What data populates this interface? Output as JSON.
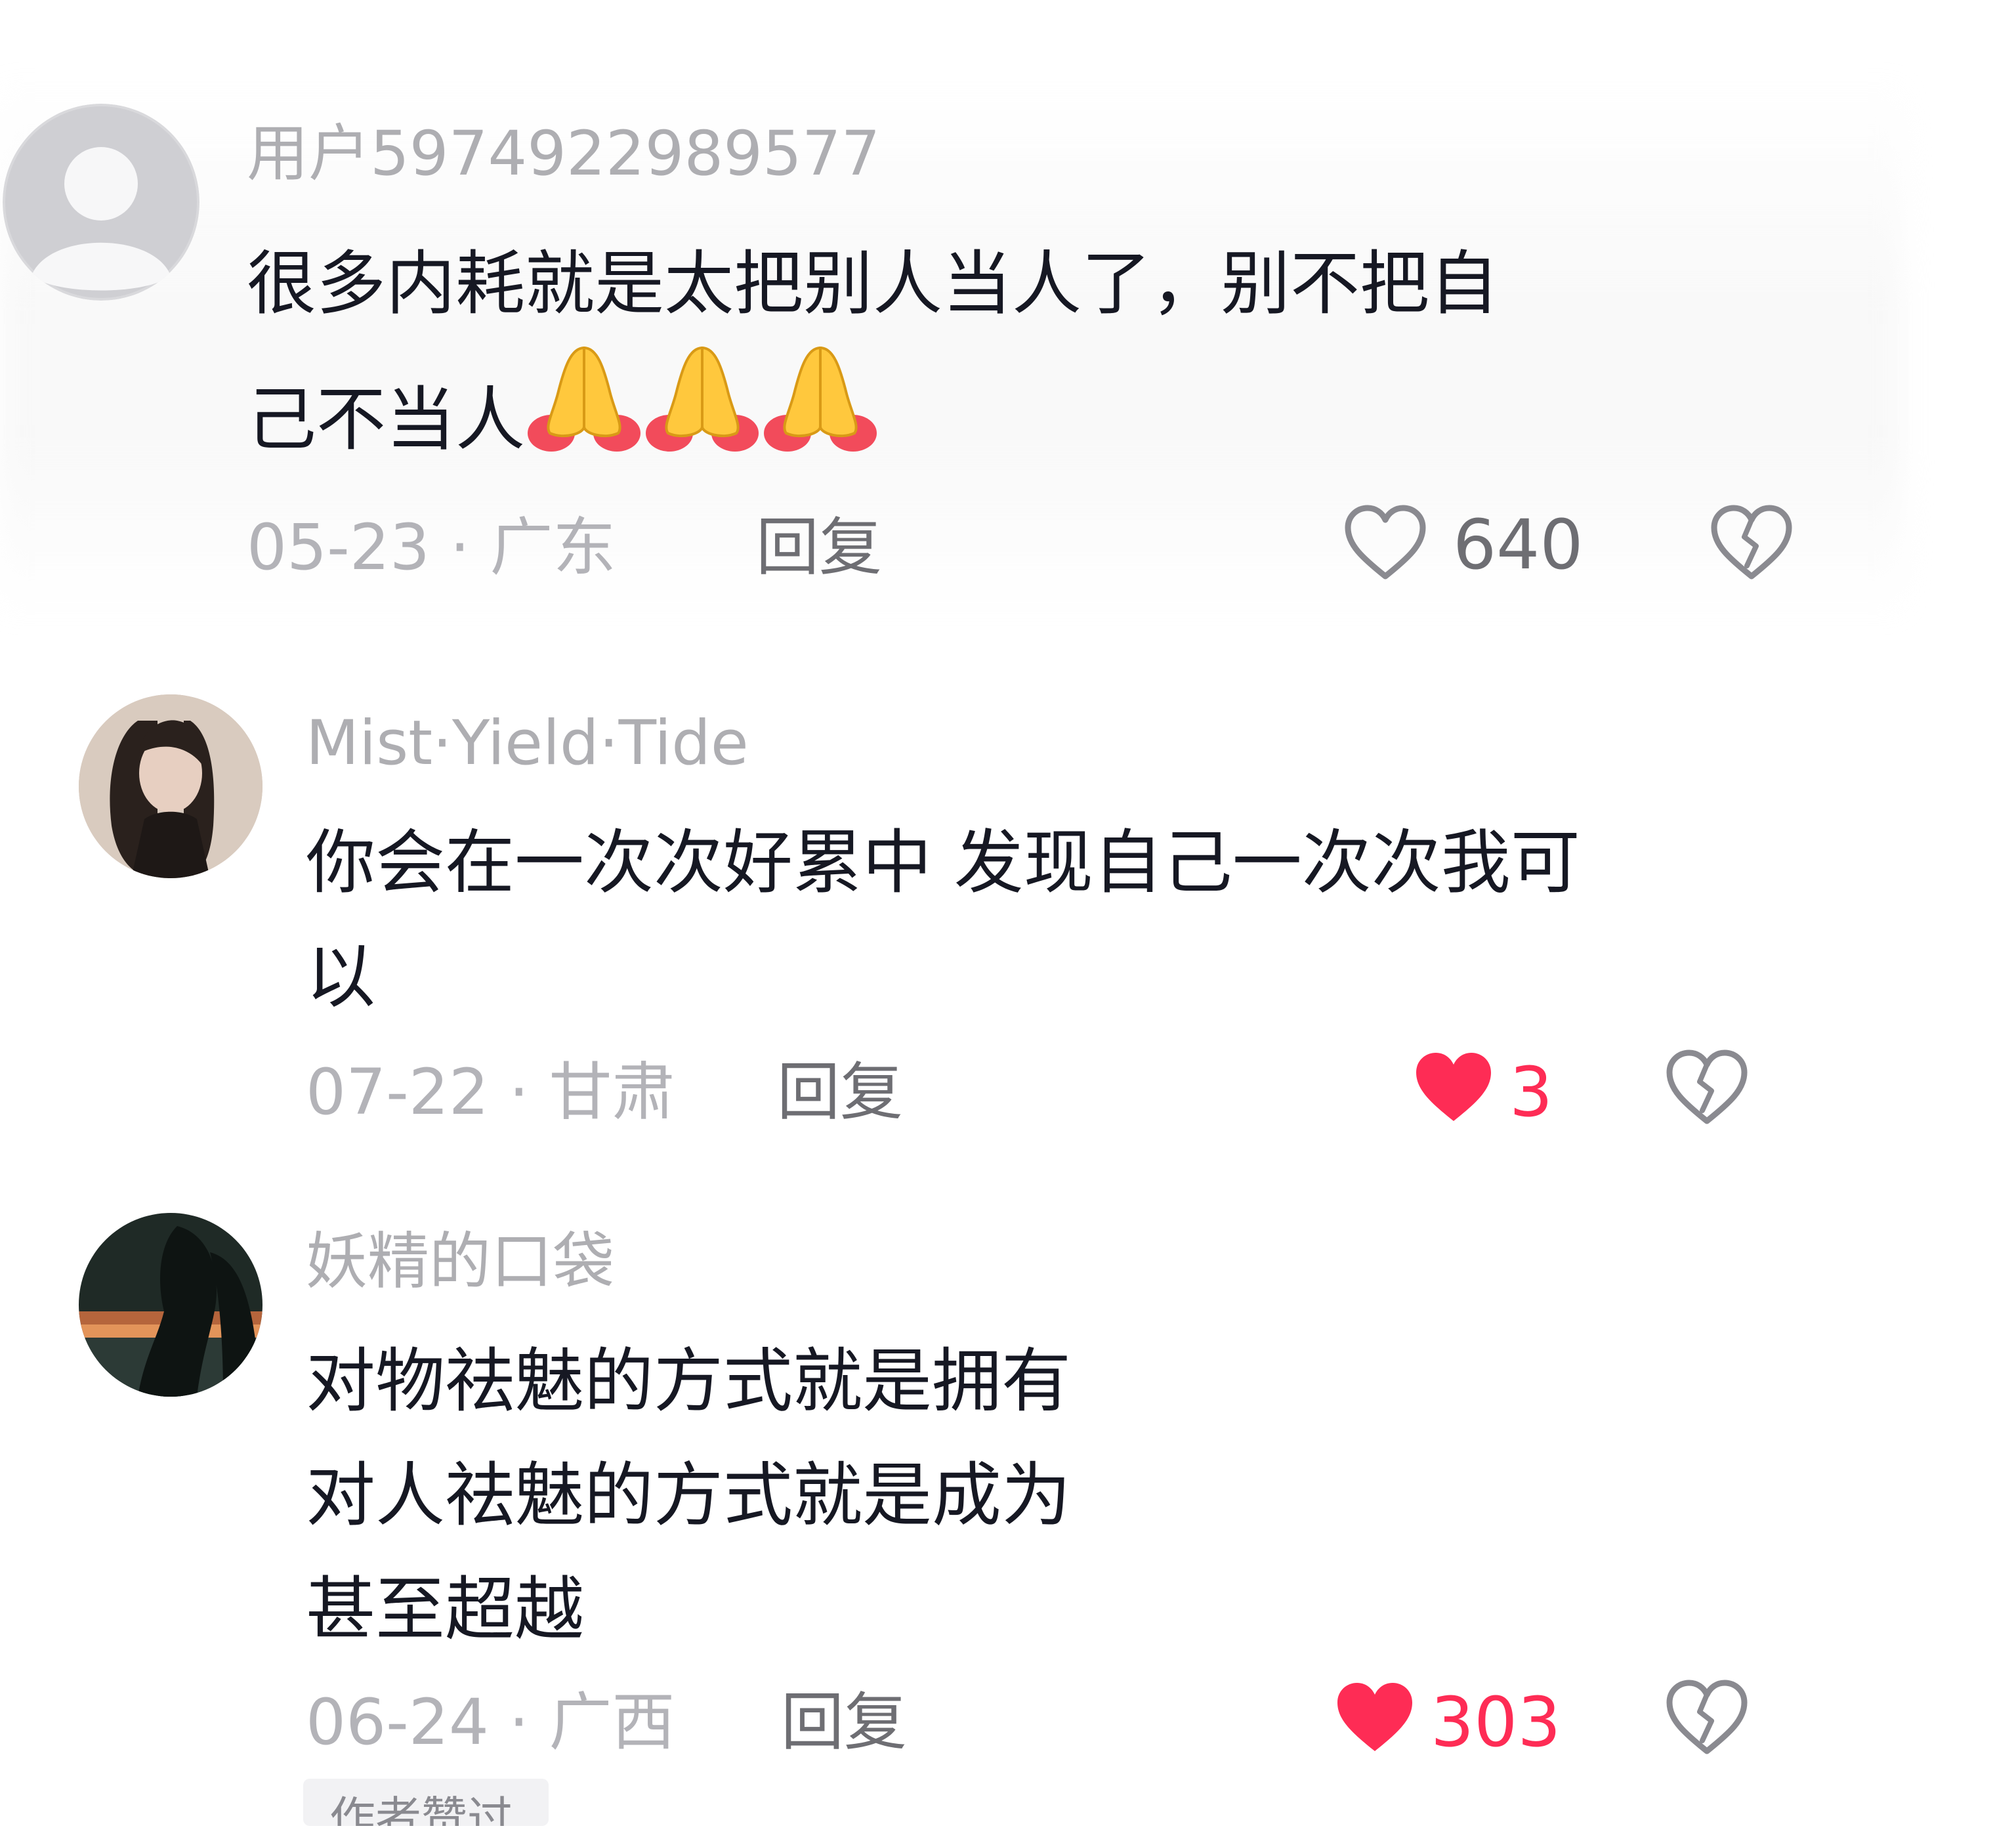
{
  "comments": [
    {
      "username": "用户5974922989577",
      "content_lines": [
        "很多内耗就是太把别人当人了，别不把自",
        "己不当人"
      ],
      "emojis": [
        "folded-hands",
        "folded-hands",
        "folded-hands"
      ],
      "date": "05-23",
      "location": "广东",
      "meta": "05-23 · 广东",
      "reply_label": "回复",
      "like_count": "640",
      "liked": false
    },
    {
      "username": "Mist·Yield·Tide",
      "content_lines": [
        "你会在一次次好累中 发现自己一次次我可",
        "以"
      ],
      "date": "07-22",
      "location": "甘肃",
      "meta": "07-22 · 甘肃",
      "reply_label": "回复",
      "like_count": "3",
      "liked": true
    },
    {
      "username": "妖精的口袋",
      "content_lines": [
        "对物祛魅的方式就是拥有",
        "对人祛魅的方式就是成为",
        "甚至超越"
      ],
      "date": "06-24",
      "location": "广西",
      "meta": "06-24 · 广西",
      "reply_label": "回复",
      "like_count": "303",
      "liked": true
    }
  ],
  "cut_tag": "作者赞过",
  "colors": {
    "liked": "#fe2c55",
    "muted": "#b3b3b8",
    "text": "#161823"
  },
  "icons": [
    "heart-outline-icon",
    "heart-filled-icon",
    "broken-heart-icon",
    "folded-hands-emoji"
  ]
}
